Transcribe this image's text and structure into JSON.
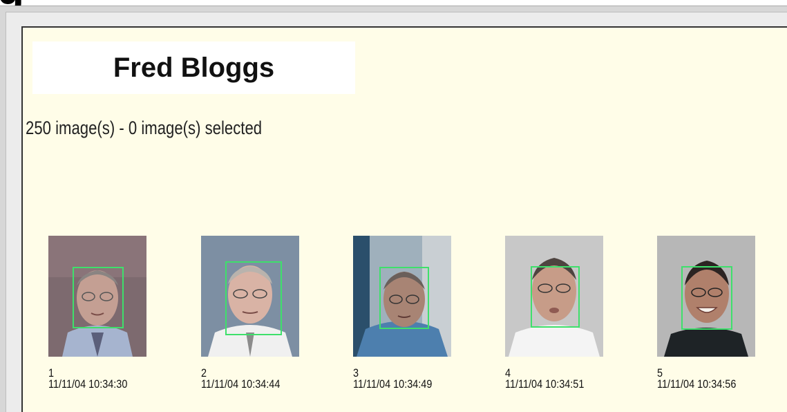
{
  "header": {
    "partial_glyph": "g"
  },
  "person": {
    "name": "Fred Bloggs"
  },
  "status": {
    "summary": "250 image(s) - 0 image(s) selected"
  },
  "colors": {
    "panel_background": "#fffde8",
    "face_box": "#3ee06b"
  },
  "images": [
    {
      "index": "1",
      "timestamp": "11/11/04 10:34:30"
    },
    {
      "index": "2",
      "timestamp": "11/11/04 10:34:44"
    },
    {
      "index": "3",
      "timestamp": "11/11/04 10:34:49"
    },
    {
      "index": "4",
      "timestamp": "11/11/04 10:34:51"
    },
    {
      "index": "5",
      "timestamp": "11/11/04 10:34:56"
    }
  ]
}
